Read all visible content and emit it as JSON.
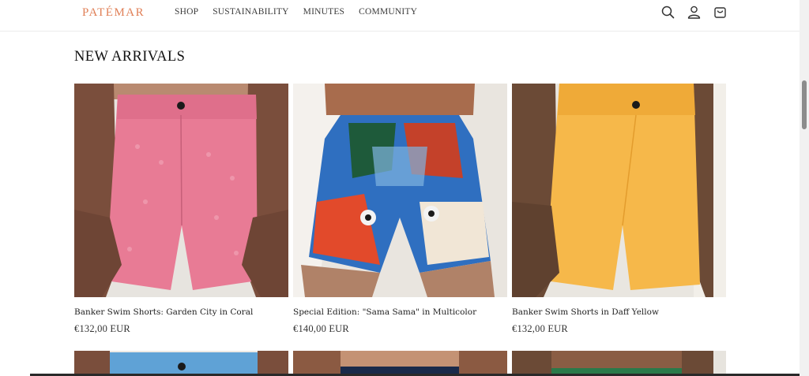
{
  "header": {
    "logo": "PATÉMAR",
    "nav": [
      "SHOP",
      "SUSTAINABILITY",
      "MINUTES",
      "COMMUNITY"
    ],
    "icons": [
      "search-icon",
      "account-icon",
      "cart-icon"
    ]
  },
  "section": {
    "title": "NEW ARRIVALS"
  },
  "products": [
    {
      "title": "Banker Swim Shorts: Garden City in Coral",
      "price": "€132,00 EUR"
    },
    {
      "title": "Special Edition: \"Sama Sama\" in Multicolor",
      "price": "€140,00 EUR"
    },
    {
      "title": "Banker Swim Shorts in Daff Yellow",
      "price": "€132,00 EUR"
    }
  ],
  "colors": {
    "logo": "#e07f56",
    "coral_shorts": "#e87b95",
    "yellow_shorts": "#f6b84a",
    "blue_shorts": "#5fa2d6"
  }
}
